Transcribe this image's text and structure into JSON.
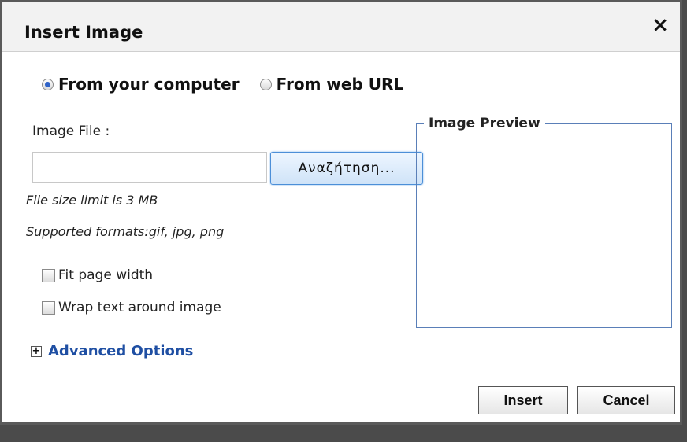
{
  "dialog": {
    "title": "Insert Image",
    "close_icon": "×"
  },
  "source": {
    "options": [
      {
        "label": "From your computer",
        "checked": true
      },
      {
        "label": "From web URL",
        "checked": false
      }
    ]
  },
  "file": {
    "label": "Image File :",
    "value": "",
    "browse_label": "Αναζήτηση...",
    "size_note": "File size limit is 3 MB",
    "formats_note": "Supported formats:gif, jpg, png"
  },
  "options": {
    "fit_page_width": "Fit page width",
    "wrap_text": "Wrap text around image"
  },
  "advanced": {
    "label": "Advanced Options",
    "expand_icon": "+"
  },
  "preview": {
    "legend": "Image Preview"
  },
  "buttons": {
    "insert": "Insert",
    "cancel": "Cancel"
  }
}
